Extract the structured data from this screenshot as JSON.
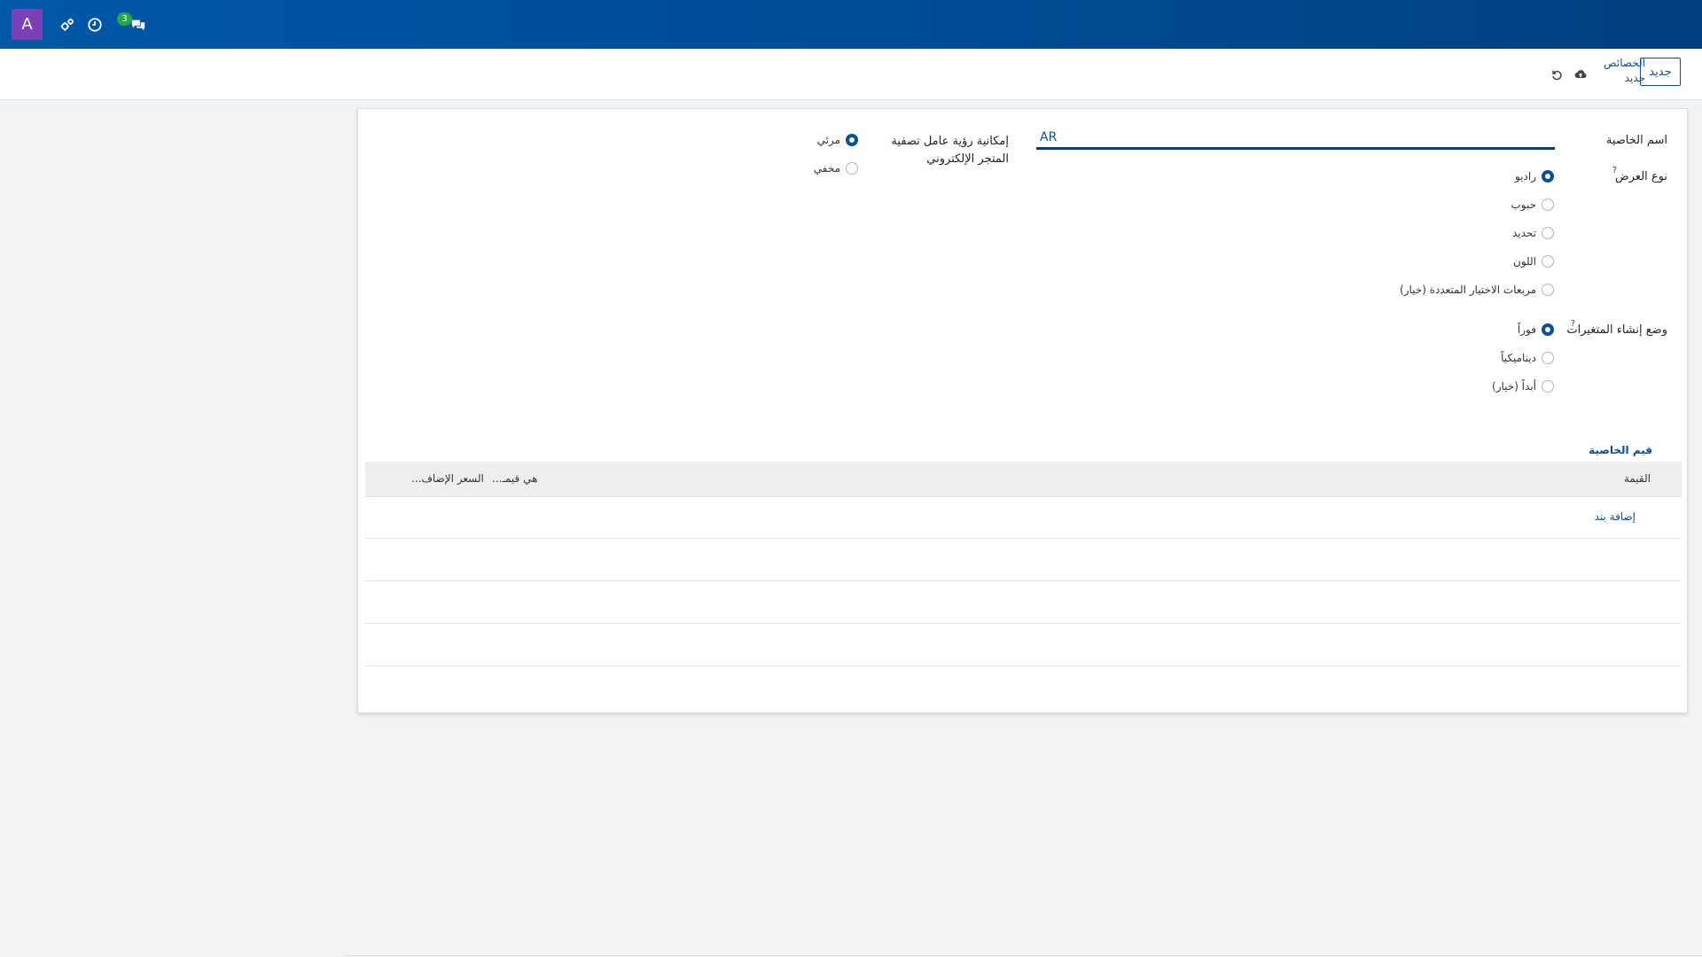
{
  "navbar": {
    "avatar_letter": "A",
    "icons": [
      "settings-cog-icon",
      "clock-icon",
      "chat-icon"
    ],
    "message_count": "3",
    "colors": {
      "navbar": "#0057a8",
      "avatar": "#7b3fb8",
      "badge": "#28a745"
    }
  },
  "control_panel": {
    "new_button_label": "جديد",
    "breadcrumb_parent": "الخصائص",
    "breadcrumb_current": "جديد",
    "icons": [
      "cloud-upload-icon",
      "undo-icon"
    ]
  },
  "form": {
    "attribute_name_label": "اسم الخاصية",
    "attribute_name_value": "AR",
    "display_type_label": "نوع العرض",
    "display_type_options": [
      {
        "label": "راديو",
        "selected": true
      },
      {
        "label": "حبوب",
        "selected": false
      },
      {
        "label": "تحديد",
        "selected": false
      },
      {
        "label": "اللون",
        "selected": false
      },
      {
        "label": "مربعات الاختيار المتعددة (خيار)",
        "selected": false
      }
    ],
    "variant_mode_label": "وضع إنشاء المتغيرات",
    "variant_mode_options": [
      {
        "label": "فوراً",
        "selected": true
      },
      {
        "label": "ديناميكياً",
        "selected": false
      },
      {
        "label": "أبداً (خيار)",
        "selected": false
      }
    ],
    "help_mark": "?",
    "visibility_label": "إمكانية رؤية عامل تصفية المتجر الإلكتروني",
    "visibility_options": [
      {
        "label": "مرئي",
        "selected": true
      },
      {
        "label": "مخفي",
        "selected": false
      }
    ]
  },
  "values_tab": {
    "tab_label": "قيم الخاصية",
    "columns": {
      "value": "القيمة",
      "is_custom": "هي قيمـ...",
      "extra_price": "السعر الإضاف..."
    },
    "add_line_label": "إضافة بند"
  }
}
